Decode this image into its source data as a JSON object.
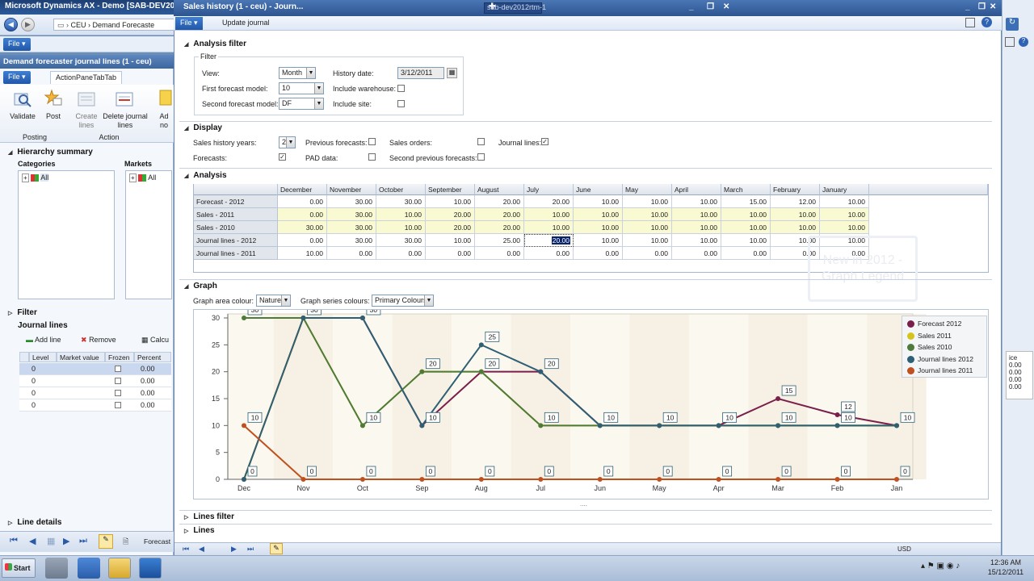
{
  "background_app": {
    "title": "Microsoft Dynamics AX - Demo [SAB-DEV20",
    "breadcrumb": [
      "CEU",
      "Demand Forecaste"
    ],
    "file_label": "File",
    "remote_title": "sab-dev2012rtm-1"
  },
  "left_window": {
    "title": "Demand forecaster journal lines (1 - ceu)",
    "file_label": "File",
    "tab_label": "ActionPaneTabTab",
    "buttons": [
      {
        "label": "Validate",
        "icon": "validate-icon"
      },
      {
        "label": "Post",
        "icon": "post-icon"
      },
      {
        "label": "Create lines",
        "icon": "create-lines-icon"
      },
      {
        "label": "Delete journal lines",
        "icon": "delete-lines-icon"
      },
      {
        "label": "Ad no",
        "icon": "add-icon"
      }
    ],
    "groups": [
      "Posting",
      "Action"
    ],
    "hierarchy_summary": "Hierarchy summary",
    "categories_label": "Categories",
    "markets_label": "Markets",
    "tree_all": "All",
    "filter_label": "Filter",
    "journal_lines_label": "Journal lines",
    "add_line": "Add line",
    "remove": "Remove",
    "calc": "Calcu",
    "columns": [
      "Level",
      "Market value",
      "Frozen",
      "Percent"
    ],
    "rows": [
      {
        "level": "0",
        "percent": "0.00"
      },
      {
        "level": "0",
        "percent": "0.00"
      },
      {
        "level": "0",
        "percent": "0.00"
      },
      {
        "level": "0",
        "percent": "0.00"
      }
    ],
    "line_details": "Line details",
    "status_text": "Forecast"
  },
  "dialog": {
    "title": "Sales history (1 - ceu) - Journ...",
    "file_label": "File",
    "update_journal": "Update journal",
    "analysis_filter": {
      "header": "Analysis filter",
      "group": "Filter",
      "view_label": "View:",
      "view_value": "Month",
      "first_model_label": "First forecast model:",
      "first_model_value": "10",
      "second_model_label": "Second forecast model:",
      "second_model_value": "DF",
      "history_date_label": "History date:",
      "history_date_value": "3/12/2011",
      "include_warehouse_label": "Include warehouse:",
      "include_site_label": "Include site:"
    },
    "display": {
      "header": "Display",
      "sales_history_years_label": "Sales history years:",
      "sales_history_years_value": "2",
      "forecasts_label": "Forecasts:",
      "previous_forecasts_label": "Previous forecasts:",
      "pad_data_label": "PAD data:",
      "sales_orders_label": "Sales orders:",
      "second_previous_forecasts_label": "Second previous forecasts:",
      "journal_lines_label": "Journal lines:"
    },
    "analysis": {
      "header": "Analysis",
      "months": [
        "December",
        "November",
        "October",
        "September",
        "August",
        "July",
        "June",
        "May",
        "April",
        "March",
        "February",
        "January"
      ],
      "rows": [
        {
          "label": "Forecast - 2012",
          "values": [
            "0.00",
            "30.00",
            "30.00",
            "10.00",
            "20.00",
            "20.00",
            "10.00",
            "10.00",
            "10.00",
            "15.00",
            "12.00",
            "10.00"
          ]
        },
        {
          "label": "Sales - 2011",
          "values": [
            "0.00",
            "30.00",
            "10.00",
            "20.00",
            "20.00",
            "10.00",
            "10.00",
            "10.00",
            "10.00",
            "10.00",
            "10.00",
            "10.00"
          ]
        },
        {
          "label": "Sales - 2010",
          "values": [
            "30.00",
            "30.00",
            "10.00",
            "20.00",
            "20.00",
            "10.00",
            "10.00",
            "10.00",
            "10.00",
            "10.00",
            "10.00",
            "10.00"
          ]
        },
        {
          "label": "Journal lines - 2012",
          "values": [
            "0.00",
            "30.00",
            "30.00",
            "10.00",
            "25.00",
            "20.00",
            "10.00",
            "10.00",
            "10.00",
            "10.00",
            "10.00",
            "10.00"
          ]
        },
        {
          "label": "Journal lines - 2011",
          "values": [
            "10.00",
            "0.00",
            "0.00",
            "0.00",
            "0.00",
            "0.00",
            "0.00",
            "0.00",
            "0.00",
            "0.00",
            "0.00",
            "0.00"
          ]
        }
      ],
      "watermark": "New in 2012 - Graph Legend"
    },
    "graph": {
      "header": "Graph",
      "area_colour_label": "Graph area colour:",
      "area_colour_value": "Nature",
      "series_colours_label": "Graph series colours:",
      "series_colours_value": "Primary Colours"
    },
    "lines_filter": "Lines filter",
    "lines": "Lines",
    "splitter": "....",
    "status_currency": "USD"
  },
  "chart_data": {
    "type": "line",
    "categories": [
      "Dec",
      "Nov",
      "Oct",
      "Sep",
      "Aug",
      "Jul",
      "Jun",
      "May",
      "Apr",
      "Mar",
      "Feb",
      "Jan"
    ],
    "ylim": [
      0,
      30
    ],
    "yticks": [
      0,
      5,
      10,
      15,
      20,
      25,
      30
    ],
    "legend_position": "top-right",
    "series": [
      {
        "name": "Forecast 2012",
        "color": "#7a1f4b",
        "values": [
          0,
          30,
          30,
          10,
          20,
          20,
          10,
          10,
          10,
          15,
          12,
          10
        ]
      },
      {
        "name": "Sales 2011",
        "color": "#d4c41c",
        "values": [
          0,
          30,
          10,
          20,
          20,
          10,
          10,
          10,
          10,
          10,
          10,
          10
        ]
      },
      {
        "name": "Sales 2010",
        "color": "#4e7a3a",
        "values": [
          30,
          30,
          10,
          20,
          20,
          10,
          10,
          10,
          10,
          10,
          10,
          10
        ]
      },
      {
        "name": "Journal lines 2012",
        "color": "#2e5f74",
        "values": [
          0,
          30,
          30,
          10,
          25,
          20,
          10,
          10,
          10,
          10,
          10,
          10
        ]
      },
      {
        "name": "Journal lines 2011",
        "color": "#c0501e",
        "values": [
          10,
          0,
          0,
          0,
          0,
          0,
          0,
          0,
          0,
          0,
          0,
          0
        ]
      }
    ],
    "data_labels": [
      {
        "x": "Dec",
        "y": 30,
        "text": "30"
      },
      {
        "x": "Dec",
        "y": 10,
        "text": "10"
      },
      {
        "x": "Dec",
        "y": 0,
        "text": "0"
      },
      {
        "x": "Nov",
        "y": 30,
        "text": "30"
      },
      {
        "x": "Nov",
        "y": 0,
        "text": "0"
      },
      {
        "x": "Oct",
        "y": 30,
        "text": "30"
      },
      {
        "x": "Oct",
        "y": 10,
        "text": "10"
      },
      {
        "x": "Oct",
        "y": 0,
        "text": "0"
      },
      {
        "x": "Sep",
        "y": 20,
        "text": "20"
      },
      {
        "x": "Sep",
        "y": 10,
        "text": "10"
      },
      {
        "x": "Sep",
        "y": 0,
        "text": "0"
      },
      {
        "x": "Aug",
        "y": 25,
        "text": "25"
      },
      {
        "x": "Aug",
        "y": 20,
        "text": "20"
      },
      {
        "x": "Aug",
        "y": 0,
        "text": "0"
      },
      {
        "x": "Jul",
        "y": 20,
        "text": "20"
      },
      {
        "x": "Jul",
        "y": 10,
        "text": "10"
      },
      {
        "x": "Jul",
        "y": 0,
        "text": "0"
      },
      {
        "x": "Jun",
        "y": 10,
        "text": "10"
      },
      {
        "x": "Jun",
        "y": 0,
        "text": "0"
      },
      {
        "x": "May",
        "y": 10,
        "text": "10"
      },
      {
        "x": "May",
        "y": 0,
        "text": "0"
      },
      {
        "x": "Apr",
        "y": 10,
        "text": "10"
      },
      {
        "x": "Apr",
        "y": 0,
        "text": "0"
      },
      {
        "x": "Mar",
        "y": 15,
        "text": "15"
      },
      {
        "x": "Mar",
        "y": 10,
        "text": "10"
      },
      {
        "x": "Mar",
        "y": 0,
        "text": "0"
      },
      {
        "x": "Feb",
        "y": 12,
        "text": "12"
      },
      {
        "x": "Feb",
        "y": 10,
        "text": "10"
      },
      {
        "x": "Feb",
        "y": 0,
        "text": "0"
      },
      {
        "x": "Jan",
        "y": 10,
        "text": "10"
      },
      {
        "x": "Jan",
        "y": 0,
        "text": "0"
      }
    ]
  },
  "taskbar": {
    "start_label": "Start",
    "time": "12:36 AM",
    "date": "15/12/2011"
  }
}
